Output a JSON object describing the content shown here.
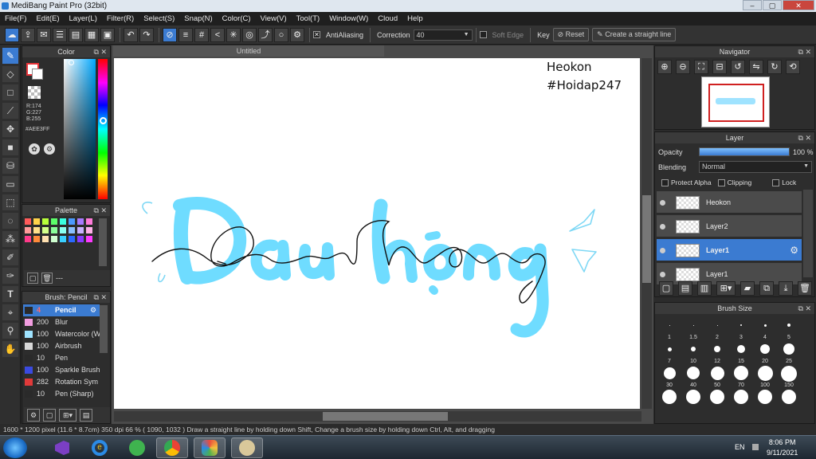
{
  "window": {
    "title": "MediBang Paint Pro (32bit)",
    "buttons": [
      "–",
      "▢",
      "✕"
    ]
  },
  "menu": [
    "File(F)",
    "Edit(E)",
    "Layer(L)",
    "Filter(R)",
    "Select(S)",
    "Snap(N)",
    "Color(C)",
    "View(V)",
    "Tool(T)",
    "Window(W)",
    "Cloud",
    "Help"
  ],
  "toolbar": {
    "antialiasing_label": "AntiAliasing",
    "correction_label": "Correction",
    "correction_value": "40",
    "soft_edge_label": "Soft Edge",
    "key_label": "Key",
    "reset_label": "Reset",
    "straight_line_label": "Create a straight line"
  },
  "color_panel": {
    "title": "Color",
    "r": "R:174",
    "g": "G:227",
    "b": "B:255",
    "hex": "#AEE3FF",
    "current_color": "#AEE3FF",
    "primary": "#e8343a"
  },
  "palette_panel": {
    "title": "Palette",
    "footer": "---",
    "swatches": [
      "#ff5a5a",
      "#ffd34a",
      "#b8ff3a",
      "#5cff6a",
      "#3affe0",
      "#4a9aff",
      "#a77aff",
      "#ff7ad9",
      "#ff9a9a",
      "#ffe08a",
      "#d4ff8a",
      "#8aff9a",
      "#8afff0",
      "#8ac0ff",
      "#c8b0ff",
      "#ffb0e8",
      "#ff3a8a",
      "#ff8a3a",
      "#ffe0b0",
      "#d0ffd0",
      "#3ad0ff",
      "#2a6aff",
      "#8a3aff",
      "#ff3aff"
    ]
  },
  "brush_panel": {
    "title": "Brush: Pencil",
    "items": [
      {
        "size": "4",
        "name": "Pencil",
        "color": "#2a2a2a",
        "selected": true
      },
      {
        "size": "200",
        "name": "Blur",
        "color": "#f29de0",
        "selected": false
      },
      {
        "size": "100",
        "name": "Watercolor (W",
        "color": "#9fe3ff",
        "selected": false
      },
      {
        "size": "100",
        "name": "Airbrush",
        "color": "#d8d8d8",
        "selected": false
      },
      {
        "size": "10",
        "name": "Pen",
        "color": "#2a2a2a",
        "selected": false
      },
      {
        "size": "100",
        "name": "Sparkle Brush",
        "color": "#3a4ae0",
        "selected": false
      },
      {
        "size": "282",
        "name": "Rotation Sym",
        "color": "#e03a3a",
        "selected": false
      },
      {
        "size": "10",
        "name": "Pen (Sharp)",
        "color": "#2a2a2a",
        "selected": false
      }
    ]
  },
  "canvas": {
    "tab_title": "Untitled",
    "text_line1": "Heokon",
    "text_line2": "#Hoidap247",
    "lettering_color": "#6fdcff"
  },
  "navigator": {
    "title": "Navigator"
  },
  "layer_panel": {
    "title": "Layer",
    "opacity_label": "Opacity",
    "opacity_value": "100 %",
    "opacity": 1.0,
    "blending_label": "Blending",
    "blending_value": "Normal",
    "protect_alpha": "Protect Alpha",
    "clipping": "Clipping",
    "lock": "Lock",
    "layers": [
      {
        "name": "Heokon",
        "selected": false
      },
      {
        "name": "Layer2",
        "selected": false
      },
      {
        "name": "Layer1",
        "selected": true
      },
      {
        "name": "Layer1",
        "selected": false
      }
    ]
  },
  "brush_size_panel": {
    "title": "Brush Size",
    "sizes": [
      "1",
      "1.5",
      "2",
      "3",
      "4",
      "5",
      "7",
      "10",
      "12",
      "15",
      "20",
      "25",
      "30",
      "40",
      "50",
      "70",
      "100",
      "150"
    ]
  },
  "status_bar": {
    "text": "1600 * 1200 pixel  (11.6 * 8.7cm)  350 dpi  66 %  ( 1090, 1032 )  Draw a straight line by holding down Shift, Change a brush size by holding down Ctrl, Alt, and dragging"
  },
  "taskbar": {
    "lang": "EN",
    "time": "8:06 PM",
    "date": "9/11/2021"
  }
}
